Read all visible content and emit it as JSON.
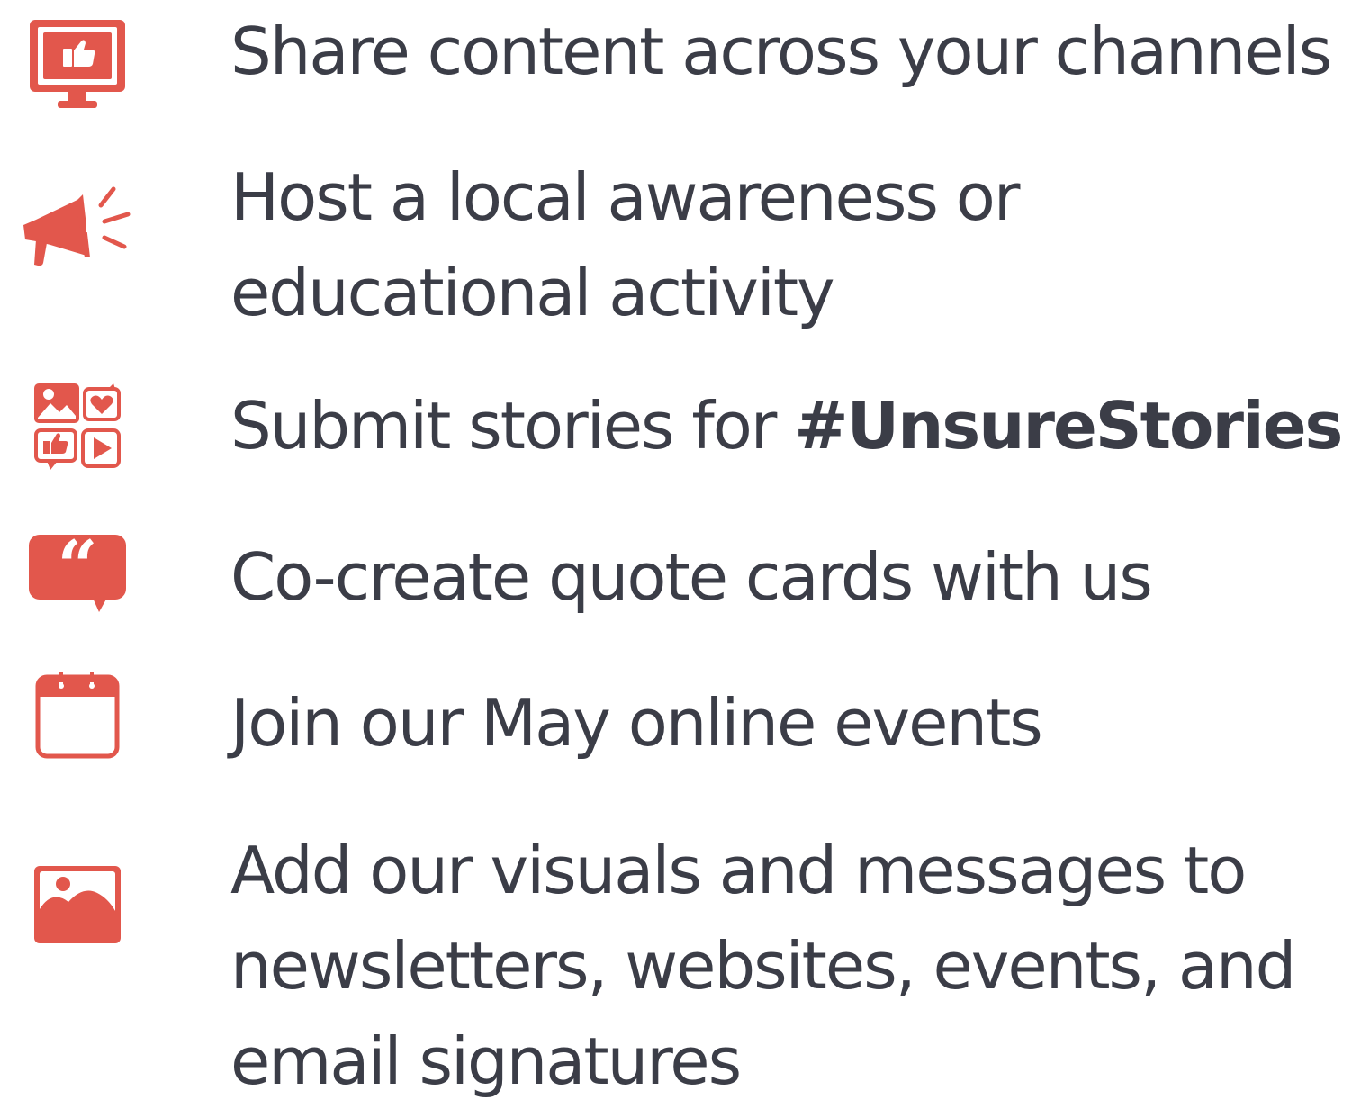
{
  "colors": {
    "accent": "#e2574c",
    "text": "#3b3d47",
    "background": "#ffffff"
  },
  "items": [
    {
      "icon": "monitor-thumbs-up-icon",
      "lines": [
        "Share content across your channels"
      ]
    },
    {
      "icon": "megaphone-icon",
      "lines": [
        "Host a local awareness or",
        "educational activity"
      ]
    },
    {
      "icon": "social-media-grid-icon",
      "text_before": "Submit stories for ",
      "text_bold": "#UnsureStories"
    },
    {
      "icon": "quote-bubble-icon",
      "lines": [
        "Co-create quote cards with us"
      ]
    },
    {
      "icon": "calendar-icon",
      "lines": [
        "Join our May online events"
      ]
    },
    {
      "icon": "image-icon",
      "lines": [
        "Add our visuals and messages to",
        "newsletters, websites, events, and",
        "email signatures"
      ]
    }
  ]
}
